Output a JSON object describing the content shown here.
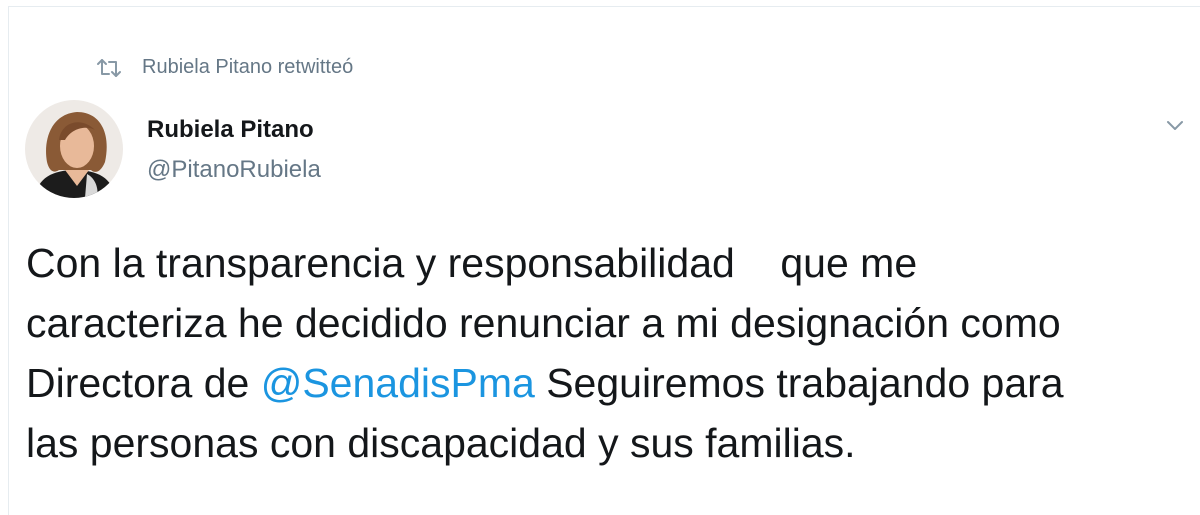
{
  "retweet_context": {
    "text": "Rubiela Pitano retwitteó",
    "icon": "retweet-icon"
  },
  "author": {
    "display_name": "Rubiela Pitano",
    "handle": "@PitanoRubiela",
    "avatar": "avatar-photo"
  },
  "menu": {
    "icon": "chevron-down-icon"
  },
  "tweet": {
    "line1": "Con la transparencia y responsabilidad    que me",
    "line2": "caracteriza he decidido renunciar a mi designación como",
    "line3_before": "Directora de ",
    "mention": "@SenadisPma",
    "line3_after": " Seguiremos trabajando para",
    "line4": "las personas con discapacidad y sus familias."
  },
  "colors": {
    "link": "#1b95e0",
    "secondary_text": "#657786",
    "primary_text": "#14171a"
  }
}
